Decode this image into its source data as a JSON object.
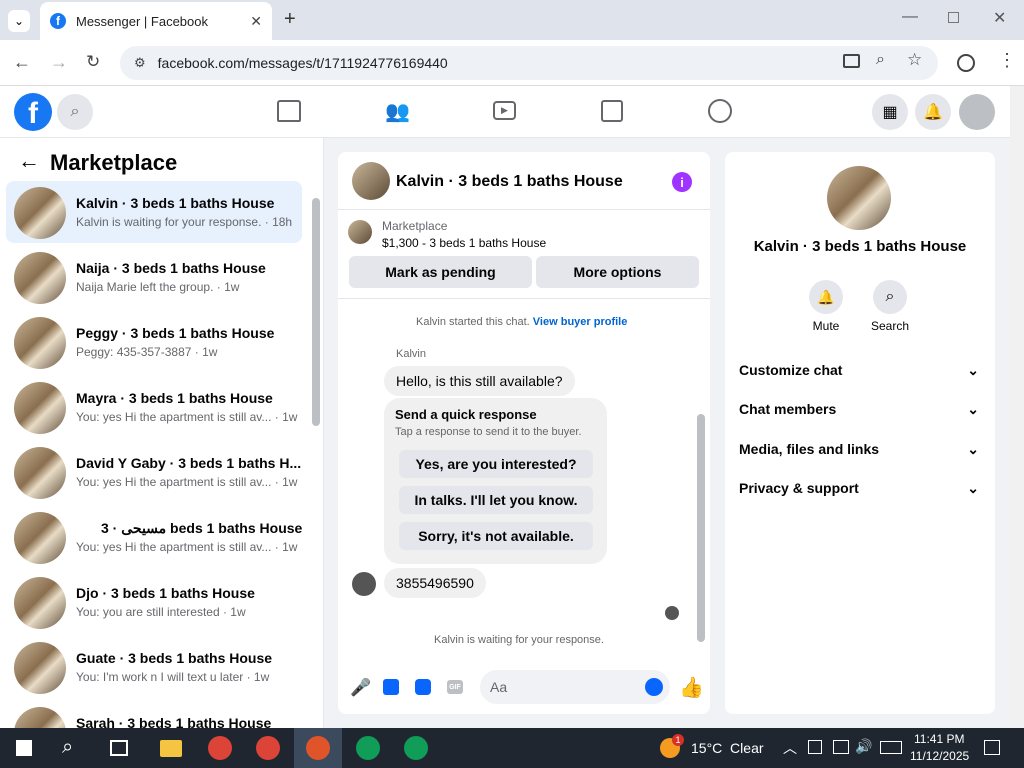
{
  "browser": {
    "tab_title": "Messenger | Facebook",
    "url": "facebook.com/messages/t/1711924776169440",
    "favicon_letter": "f"
  },
  "sidebar": {
    "header": "Marketplace",
    "conversations": [
      {
        "title": "Kalvin · 3 beds 1 baths House",
        "sub": "Kalvin is waiting for your response. · 18h"
      },
      {
        "title": "Naija · 3 beds 1 baths House",
        "sub": "Naija Marie left the group. · 1w"
      },
      {
        "title": "Peggy · 3 beds 1 baths House",
        "sub": "Peggy: 435-357-3887 · 1w"
      },
      {
        "title": "Mayra · 3 beds 1 baths House",
        "sub": "You: yes Hi the apartment is still av... · 1w"
      },
      {
        "title": "David Y Gaby · 3 beds 1 baths H...",
        "sub": "You: yes Hi the apartment is still av... · 1w"
      },
      {
        "title": "مسيحى · 3 beds 1 baths House",
        "sub": "You: yes Hi the apartment is still av... · 1w"
      },
      {
        "title": "Djo · 3 beds 1 baths House",
        "sub": "You: you are still interested · 1w"
      },
      {
        "title": "Guate · 3 beds 1 baths House",
        "sub": "You: I'm work n I will text u later · 1w"
      },
      {
        "title": "Sarah · 3 beds 1 baths House",
        "sub": ""
      }
    ]
  },
  "chat": {
    "title": "Kalvin · 3 beds 1 baths House",
    "listing_label": "Marketplace",
    "listing_detail": "$1,300 - 3 beds 1 baths House",
    "mark_pending": "Mark as pending",
    "more_options": "More options",
    "started_text": "Kalvin started this chat.",
    "view_profile": "View buyer profile",
    "sender_name": "Kalvin",
    "msg1": "Hello, is this still available?",
    "quick_title": "Send a quick response",
    "quick_sub": "Tap a response to send it to the buyer.",
    "quick_replies": [
      "Yes, are you interested?",
      "In talks. I'll let you know.",
      "Sorry, it's not available."
    ],
    "msg2": "3855496590",
    "waiting": "Kalvin is waiting for your response.",
    "input_placeholder": "Aa"
  },
  "info": {
    "title": "Kalvin · 3 beds 1 baths House",
    "mute": "Mute",
    "search": "Search",
    "sections": [
      "Customize chat",
      "Chat members",
      "Media, files and links",
      "Privacy & support"
    ]
  },
  "taskbar": {
    "weather": "15°C  Clear",
    "time": "11:41 PM",
    "date": "11/12/2025",
    "badge": "1"
  },
  "colors": {
    "fb_blue": "#1877f2",
    "accent_purple": "#a033ff",
    "active_row": "#e7f0fd"
  }
}
